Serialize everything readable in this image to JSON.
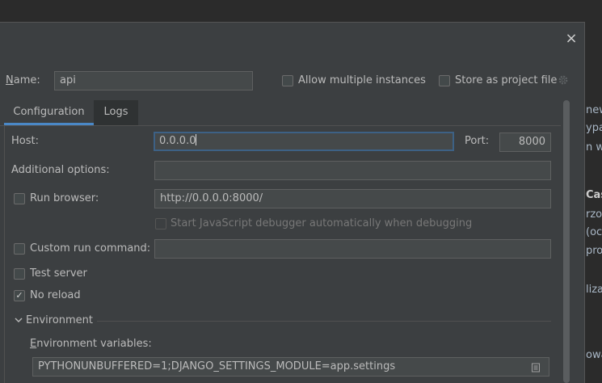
{
  "background_doc": {
    "lines": [
      "new",
      "ypac",
      "n wr",
      "Cas",
      "rzow",
      "(oc",
      "pro",
      "liza",
      "owa"
    ]
  },
  "dialog": {
    "close_symbol": "×",
    "name_label": "Name:",
    "name_value": "api",
    "allow_multiple_label": "Allow multiple instances",
    "store_label": "Store as project file",
    "tabs": [
      {
        "label": "Configuration",
        "active": true
      },
      {
        "label": "Logs",
        "active": false
      }
    ],
    "host_label": "Host:",
    "host_value": "0.0.0.0",
    "port_label": "Port:",
    "port_value": "8000",
    "additional_label": "Additional options:",
    "additional_value": "",
    "run_browser_label": "Run browser:",
    "run_browser_checked": false,
    "run_browser_url": "http://0.0.0.0:8000/",
    "js_debugger_label": "Start JavaScript debugger automatically when debugging",
    "custom_cmd_label": "Custom run command:",
    "custom_cmd_value": "",
    "test_server_label": "Test server",
    "no_reload_label": "No reload",
    "no_reload_checked": true,
    "environment_label": "Environment",
    "env_vars_label": "Environment variables:",
    "env_vars_value": "PYTHONUNBUFFERED=1;DJANGO_SETTINGS_MODULE=app.settings"
  },
  "colors": {
    "dialog_bg": "#3c3f41",
    "accent": "#4a88c7",
    "focus_border": "#3d6185"
  }
}
